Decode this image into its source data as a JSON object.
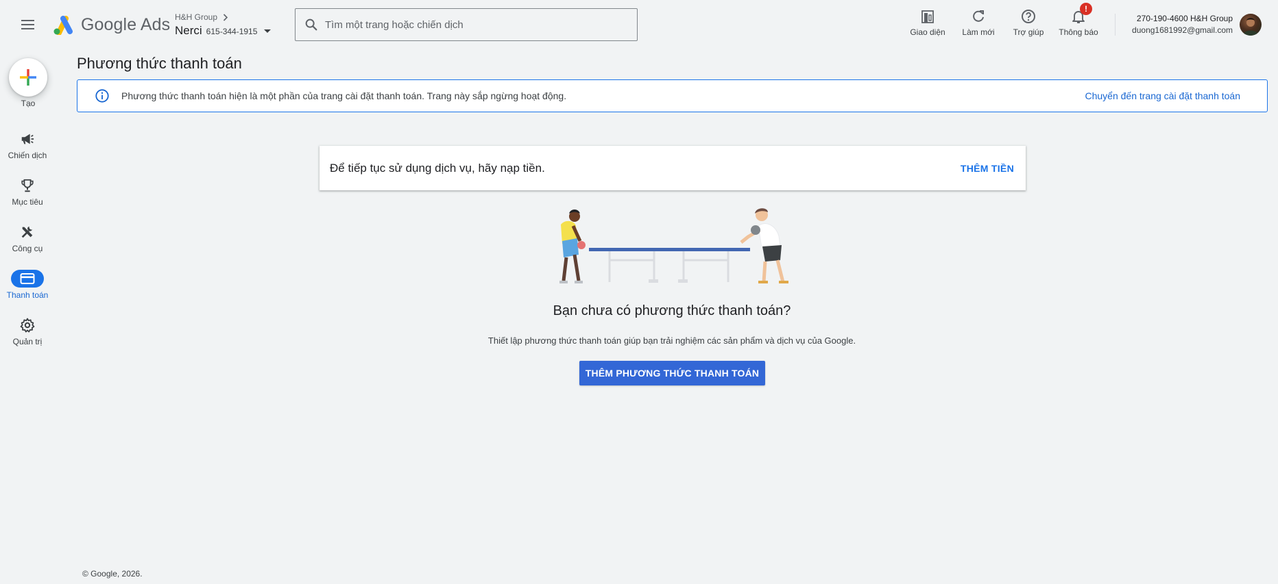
{
  "header": {
    "product_name": "Google Ads",
    "account_group": "H&H Group",
    "account_name": "Nerci",
    "account_id": "615-344-1915",
    "search_placeholder": "Tìm một trang hoặc chiến dịch",
    "tools": [
      {
        "label": "Giao diện",
        "icon": "appearance-icon"
      },
      {
        "label": "Làm mới",
        "icon": "refresh-icon"
      },
      {
        "label": "Trợ giúp",
        "icon": "help-icon"
      },
      {
        "label": "Thông báo",
        "icon": "bell-icon",
        "badge": "!"
      }
    ],
    "user_account_line": "270-190-4600 H&H Group",
    "user_email": "duong1681992@gmail.com"
  },
  "nav": {
    "create_label": "Tạo",
    "items": [
      {
        "label": "Chiến dịch",
        "icon": "megaphone-icon"
      },
      {
        "label": "Mục tiêu",
        "icon": "trophy-icon"
      },
      {
        "label": "Công cụ",
        "icon": "tools-icon"
      },
      {
        "label": "Thanh toán",
        "icon": "credit-card-icon",
        "active": true
      },
      {
        "label": "Quản trị",
        "icon": "gear-icon"
      }
    ]
  },
  "main": {
    "title": "Phương thức thanh toán",
    "banner_message": "Phương thức thanh toán hiện là một phần của trang cài đặt thanh toán. Trang này sắp ngừng hoạt động.",
    "banner_link": "Chuyển đến trang cài đặt thanh toán",
    "funds_message": "Để tiếp tục sử dụng dịch vụ, hãy nạp tiền.",
    "funds_button": "THÊM TIỀN",
    "empty_title": "Bạn chưa có phương thức thanh toán?",
    "empty_description": "Thiết lập phương thức thanh toán giúp bạn trải nghiệm các sản phẩm và dịch vụ của Google.",
    "cta_button": "THÊM PHƯƠNG THỨC THANH TOÁN"
  },
  "footer": {
    "copyright": "© Google, 2026."
  },
  "colors": {
    "accent": "#1a73e8",
    "cta": "#3367d6",
    "badge": "#d93025",
    "background": "#f1f3f4"
  }
}
